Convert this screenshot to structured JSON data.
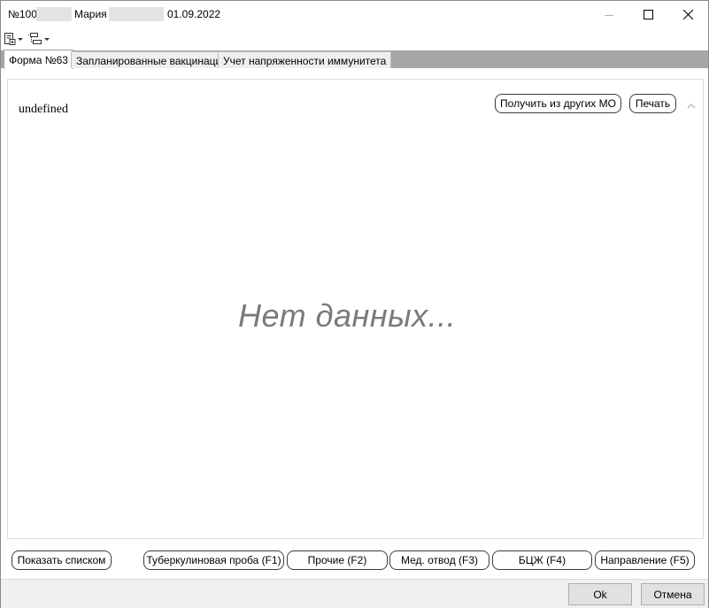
{
  "titlebar": {
    "number_label": "№100",
    "name_label": "Мария",
    "date_label": "01.09.2022"
  },
  "toolbar": {
    "icons": [
      "document-settings-icon",
      "tree-structure-icon"
    ]
  },
  "tabs": [
    {
      "label": "Форма №63",
      "active": true
    },
    {
      "label": "Запланированные вакцинации",
      "active": false
    },
    {
      "label": "Учет напряженности иммунитета",
      "active": false
    }
  ],
  "content": {
    "header_text": "undefined",
    "get_from_other_mo_label": "Получить из других МО",
    "print_label": "Печать",
    "empty_text": "Нет данных..."
  },
  "bottom_buttons": {
    "show_list": "Показать списком",
    "tuberculin": "Туберкулиновая проба (F1)",
    "other": "Прочие (F2)",
    "med_exemption": "Мед. отвод (F3)",
    "bcg": "БЦЖ (F4)",
    "referral": "Направление (F5)"
  },
  "footer": {
    "ok_label": "Ok",
    "cancel_label": "Отмена"
  }
}
